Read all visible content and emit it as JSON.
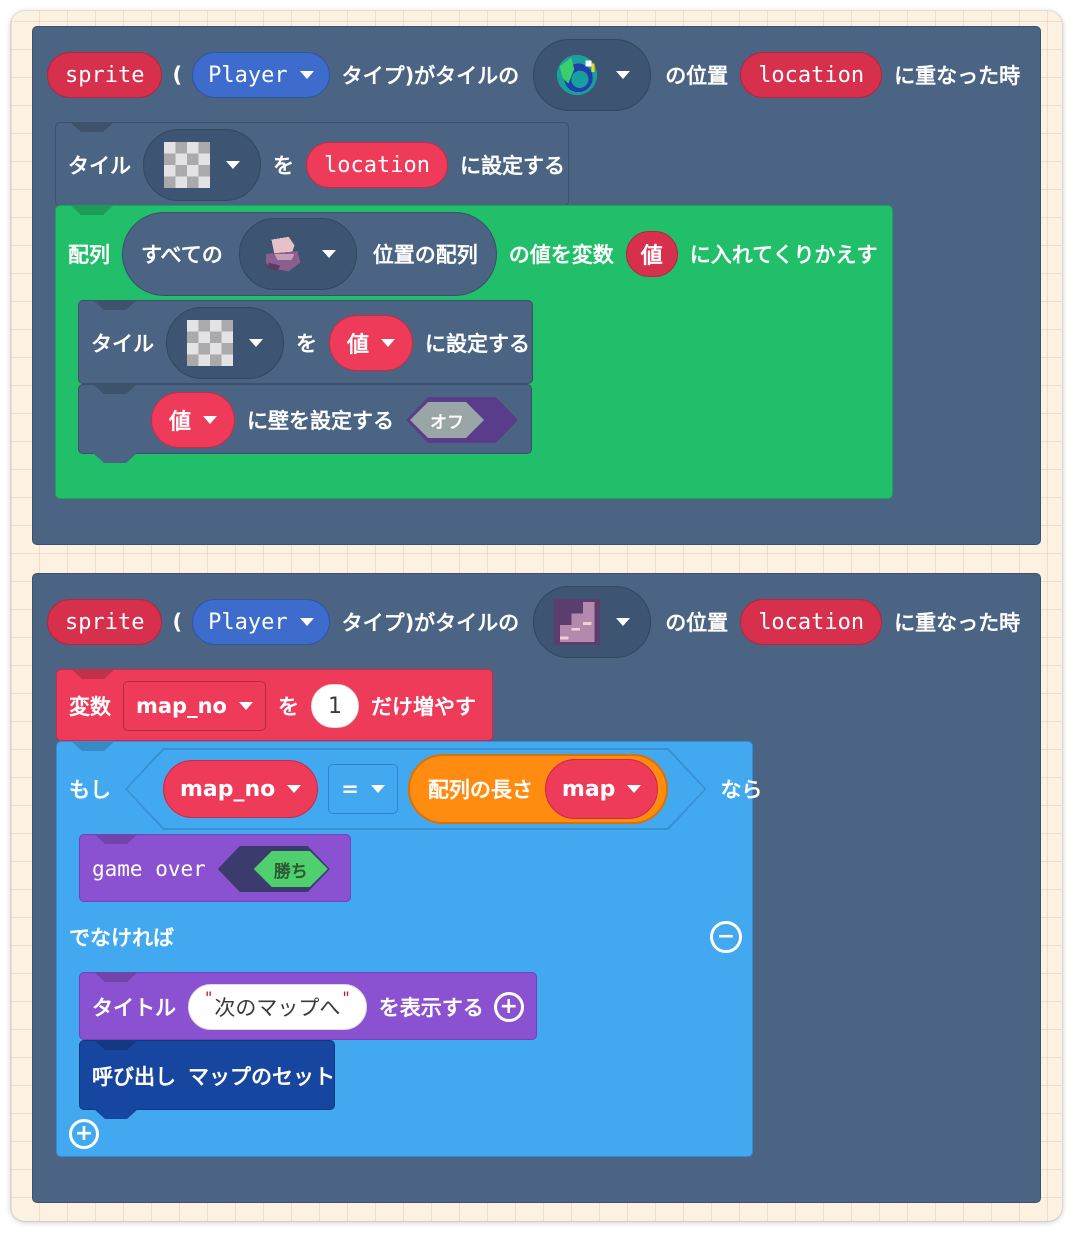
{
  "event1": {
    "sprite_label": "sprite",
    "open_paren": "(",
    "kind_value": "Player",
    "type_text": "タイプ)がタイルの",
    "tile_icon": "earth-globe-tile-icon",
    "position_text": "の位置",
    "location_label": "location",
    "overlap_text": "に重なった時",
    "set_tile": {
      "prefix": "タイル",
      "tile_icon": "transparent-checker-tile-icon",
      "wo": "を",
      "location_label": "location",
      "suffix": "に設定する"
    },
    "for_each": {
      "prefix": "配列",
      "all_text": "すべての",
      "tile_icon": "rock-tile-icon",
      "array_text": "位置の配列",
      "value_text": "の値を変数",
      "var_label": "値",
      "loop_text": "に入れてくりかえす",
      "body": {
        "set_tile": {
          "prefix": "タイル",
          "tile_icon": "transparent-checker-tile-icon",
          "wo": "を",
          "var_label": "値",
          "suffix": "に設定する"
        },
        "set_wall": {
          "var_label": "値",
          "text": "に壁を設定する",
          "toggle_label": "オフ"
        }
      }
    }
  },
  "event2": {
    "sprite_label": "sprite",
    "open_paren": "(",
    "kind_value": "Player",
    "type_text": "タイプ)がタイルの",
    "tile_icon": "stairs-tile-icon",
    "position_text": "の位置",
    "location_label": "location",
    "overlap_text": "に重なった時",
    "change_var": {
      "prefix": "変数",
      "var_name": "map_no",
      "wo": "を",
      "amount": "1",
      "suffix": "だけ増やす"
    },
    "if_block": {
      "if_text": "もし",
      "left_var": "map_no",
      "operator": "=",
      "array_length_text": "配列の長さ",
      "array_var": "map",
      "then_text": "なら",
      "game_over": {
        "label": "game over",
        "toggle_label": "勝ち"
      },
      "else_text": "でなければ",
      "show_title": {
        "prefix": "タイトル",
        "text_value": "次のマップへ",
        "suffix": "を表示する"
      },
      "call_func": {
        "label": "呼び出し",
        "func_name": "マップのセット"
      }
    }
  },
  "colors": {
    "event": "#4b6483",
    "loops": "#22bf6a",
    "variables": "#ed3b59",
    "logic": "#42a9f0",
    "game": "#8a52d0",
    "functions": "#1746a0",
    "arrays": "#ff8c10",
    "workspace": "#fdf2e1"
  }
}
